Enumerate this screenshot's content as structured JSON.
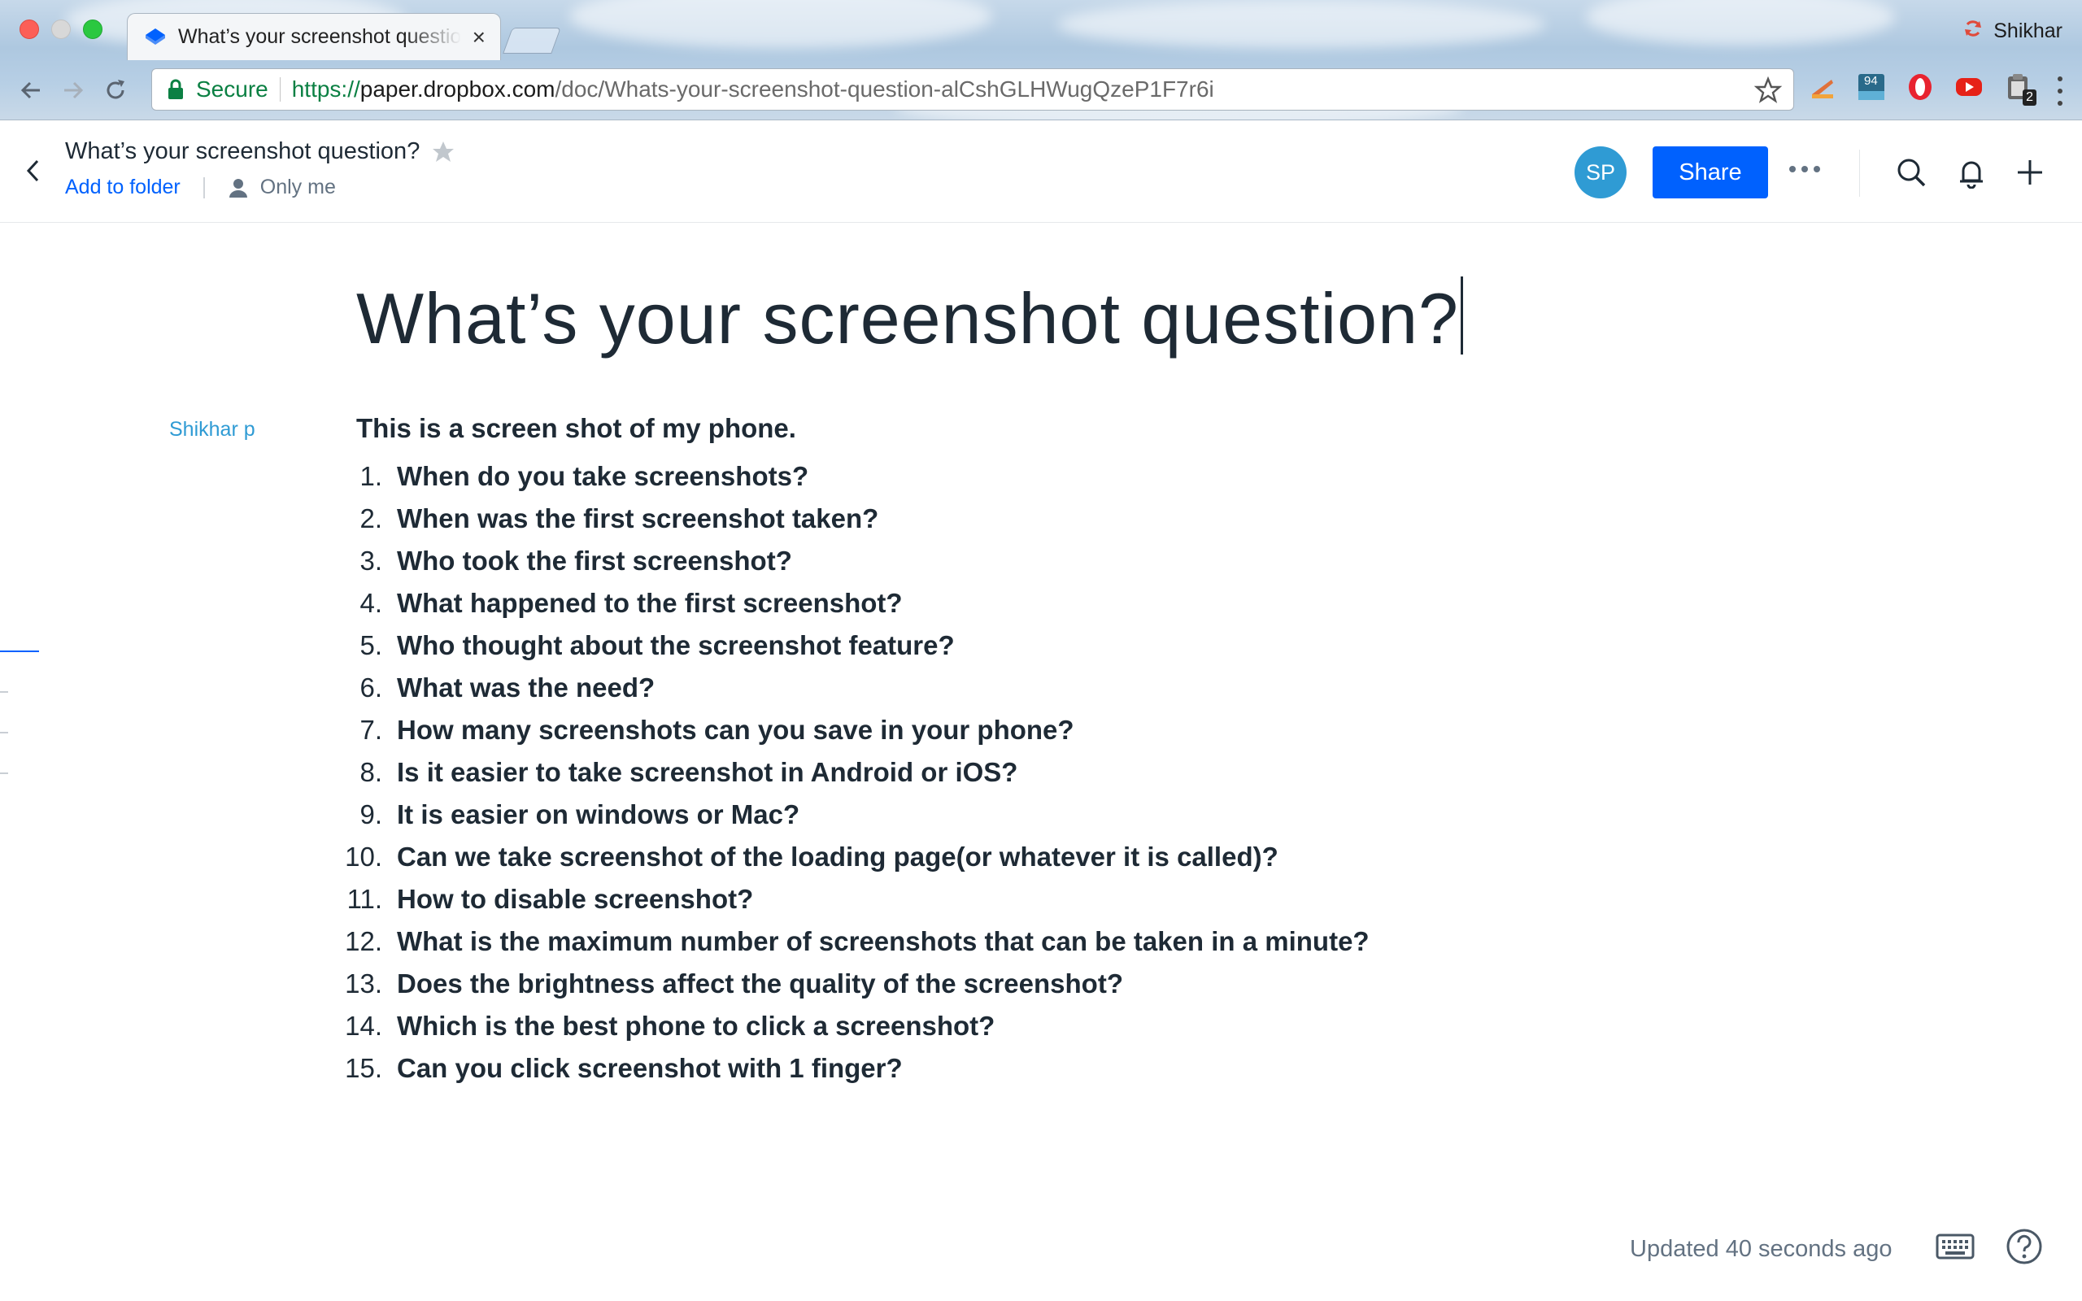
{
  "browser": {
    "tab": {
      "title": "What’s your screenshot question?",
      "close_label": "×"
    },
    "profile_name": "Shikhar",
    "omnibox": {
      "secure_label": "Secure",
      "url_scheme": "https://",
      "url_host": "paper.dropbox.com",
      "url_path": "/doc/Whats-your-screenshot-question-alCshGLHWugQzeP1F7r6i"
    },
    "extensions": [
      {
        "name": "paint-icon"
      },
      {
        "name": "counter-icon",
        "badge": "94"
      },
      {
        "name": "opera-icon"
      },
      {
        "name": "youtube-icon"
      },
      {
        "name": "clipboard-icon",
        "badge": "2"
      }
    ]
  },
  "header": {
    "doc_title": "What’s your screenshot question?",
    "add_to_folder": "Add to folder",
    "sharing_label": "Only me",
    "avatar_initials": "SP",
    "share_label": "Share"
  },
  "doc": {
    "title": "What’s your screenshot question?",
    "author": "Shikhar p",
    "intro": "This is a screen shot of my phone.",
    "questions": [
      {
        "num": "1.",
        "text": "When do you take screenshots?"
      },
      {
        "num": "2.",
        "text": "When was the first screenshot taken?"
      },
      {
        "num": "3.",
        "text": "Who took the first screenshot?"
      },
      {
        "num": "4.",
        "text": "What happened to the first screenshot?"
      },
      {
        "num": "5.",
        "text": "Who thought about the screenshot feature?"
      },
      {
        "num": "6.",
        "text": "What was the need?"
      },
      {
        "num": "7.",
        "text": "How many screenshots can you save in your phone?"
      },
      {
        "num": "8.",
        "text": "Is it easier to take screenshot in Android or iOS?"
      },
      {
        "num": "9.",
        "text": "It is easier on windows or Mac?"
      },
      {
        "num": "10.",
        "text": "Can we take screenshot of the loading page(or whatever it is called)?"
      },
      {
        "num": "11.",
        "text": "How to disable screenshot?"
      },
      {
        "num": "12.",
        "text": "What is the maximum number of screenshots that can be taken in a minute?"
      },
      {
        "num": "13.",
        "text": "Does the brightness affect the quality of the screenshot?"
      },
      {
        "num": "14.",
        "text": "Which is the best phone to click a screenshot?"
      },
      {
        "num": "15.",
        "text": "Can you click screenshot with 1 finger?"
      }
    ]
  },
  "footer": {
    "updated": "Updated 40 seconds ago"
  },
  "colors": {
    "accent": "#0061fe",
    "avatar": "#2f9bd4",
    "text": "#1e2a35",
    "muted": "#637282",
    "secure": "#0b8043"
  }
}
